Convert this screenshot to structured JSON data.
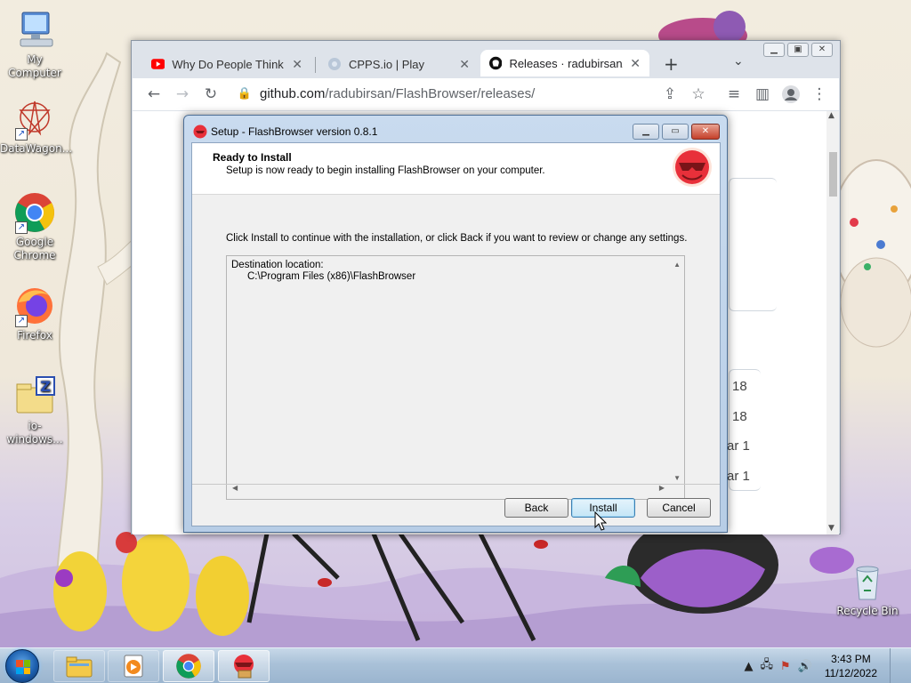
{
  "desktop": {
    "icons": [
      {
        "label": "My Computer",
        "icon": "computer-icon"
      },
      {
        "label": "DataWagon...",
        "icon": "datawagon-icon"
      },
      {
        "label": "Google Chrome",
        "icon": "chrome-icon"
      },
      {
        "label": "Firefox",
        "icon": "firefox-icon"
      },
      {
        "label": "io-windows...",
        "icon": "zip-folder-icon"
      },
      {
        "label": "Recycle Bin",
        "icon": "recycle-bin-icon"
      }
    ]
  },
  "browser": {
    "tabs": [
      {
        "title": "Why Do People Think I",
        "icon": "youtube-icon"
      },
      {
        "title": "CPPS.io | Play",
        "icon": "cpps-icon"
      },
      {
        "title": "Releases · radubirsan/Fl",
        "icon": "github-icon"
      }
    ],
    "url_domain": "github.com",
    "url_path": "/radubirsan/FlashBrowser/releases/",
    "page_fragments": [
      "18",
      "18",
      "ar 1",
      "ar 1"
    ]
  },
  "dialog": {
    "title": "Setup - FlashBrowser version 0.8.1",
    "heading": "Ready to Install",
    "subheading": "Setup is now ready to begin installing FlashBrowser on your computer.",
    "instructions": "Click Install to continue with the installation, or click Back if you want to review or change any settings.",
    "memo_label": "Destination location:",
    "memo_value": "C:\\Program Files (x86)\\FlashBrowser",
    "buttons": {
      "back": "Back",
      "install": "Install",
      "cancel": "Cancel"
    }
  },
  "taskbar": {
    "time": "3:43 PM",
    "date": "11/12/2022"
  },
  "colors": {
    "dialog_frame": "#c9dbef",
    "logo_red": "#e8303a",
    "taskbar": "#a9c1d8"
  }
}
